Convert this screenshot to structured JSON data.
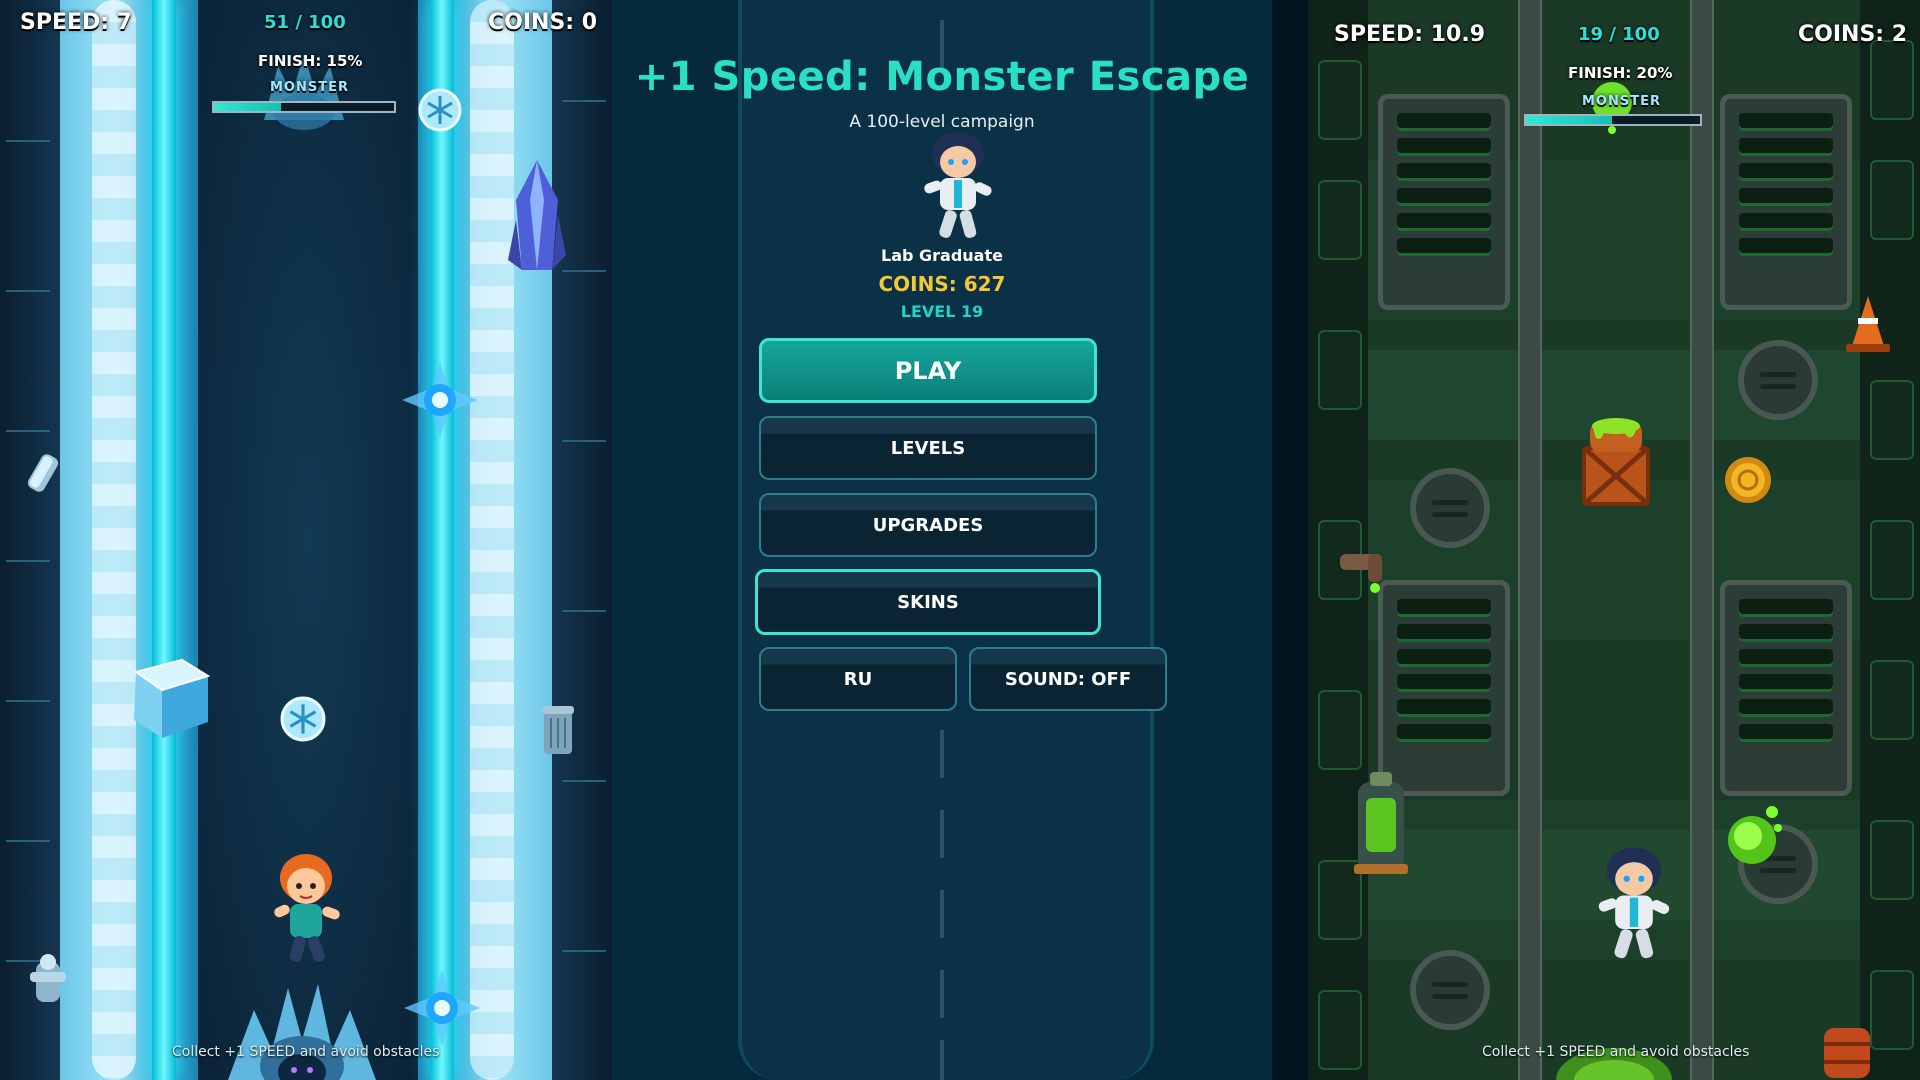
{
  "left_game": {
    "speed": "SPEED: 7",
    "progress": "51 / 100",
    "coins": "COINS: 0",
    "finish": "FINISH: 15%",
    "monster_label": "MONSTER",
    "finish_fraction": 0.15,
    "hint": "Collect +1 SPEED and avoid obstacles",
    "theme_colors": {
      "beam": "#22e4ff",
      "ice": "#9be2f6"
    }
  },
  "menu": {
    "title": "+1 Speed: Monster Escape",
    "subtitle": "A 100-level campaign",
    "skin_name": "Lab Graduate",
    "coins": "COINS: 627",
    "level": "LEVEL 19",
    "buttons": {
      "play": "PLAY",
      "levels": "LEVELS",
      "upgrades": "UPGRADES",
      "skins": "SKINS",
      "language": "RU",
      "sound": "SOUND: OFF"
    },
    "colors": {
      "title": "#29e1c2",
      "coins": "#f5c638",
      "accent": "#3de5d2"
    }
  },
  "right_game": {
    "speed": "SPEED: 10.9",
    "progress": "19 / 100",
    "coins": "COINS: 2",
    "finish": "FINISH: 20%",
    "monster_label": "MONSTER",
    "finish_fraction": 0.2,
    "hint": "Collect +1 SPEED and avoid obstacles",
    "theme_colors": {
      "slime": "#7cff2e",
      "floor": "#1a3a26"
    }
  }
}
